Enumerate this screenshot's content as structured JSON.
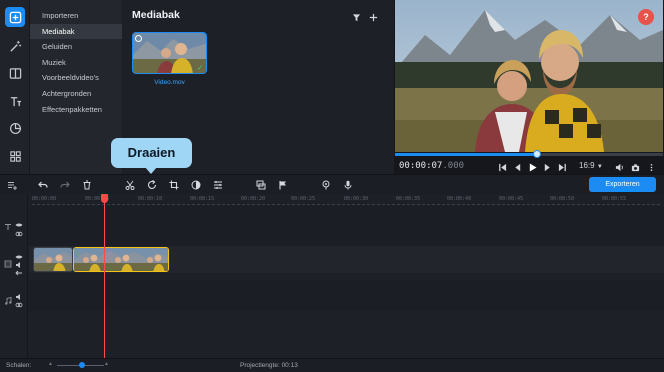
{
  "sidebar_categories": [
    "Importeren",
    "Mediabak",
    "Geluiden",
    "Muziek",
    "Voorbeeldvideo's",
    "Achtergronden",
    "Effectenpakketten"
  ],
  "media_bin": {
    "title": "Mediabak",
    "clip_name": "Video.mov"
  },
  "player": {
    "timecode_main": "00:00:07",
    "timecode_frac": ".000",
    "aspect_ratio": "16:9",
    "progress": 0.53,
    "help_label": "?"
  },
  "toolbar": {
    "export_label": "Exporteren",
    "tooltip": "Draaien"
  },
  "timeline": {
    "ruler_labels": [
      "00:00:00",
      "00:00:05",
      "00:00:10",
      "00:00:15",
      "00:00:20",
      "00:00:25",
      "00:00:30",
      "00:00:35",
      "00:00:40",
      "00:00:45",
      "00:00:50",
      "00:00:55"
    ]
  },
  "status_bar": {
    "scale_label": "Schalen:",
    "project_length_label": "Projectlengte:",
    "project_length_value": "00:13"
  },
  "colors": {
    "accent": "#1d8cf2",
    "selection": "#f3c316",
    "playhead": "#ff4a4a",
    "tooltip": "#9fd6f6"
  }
}
